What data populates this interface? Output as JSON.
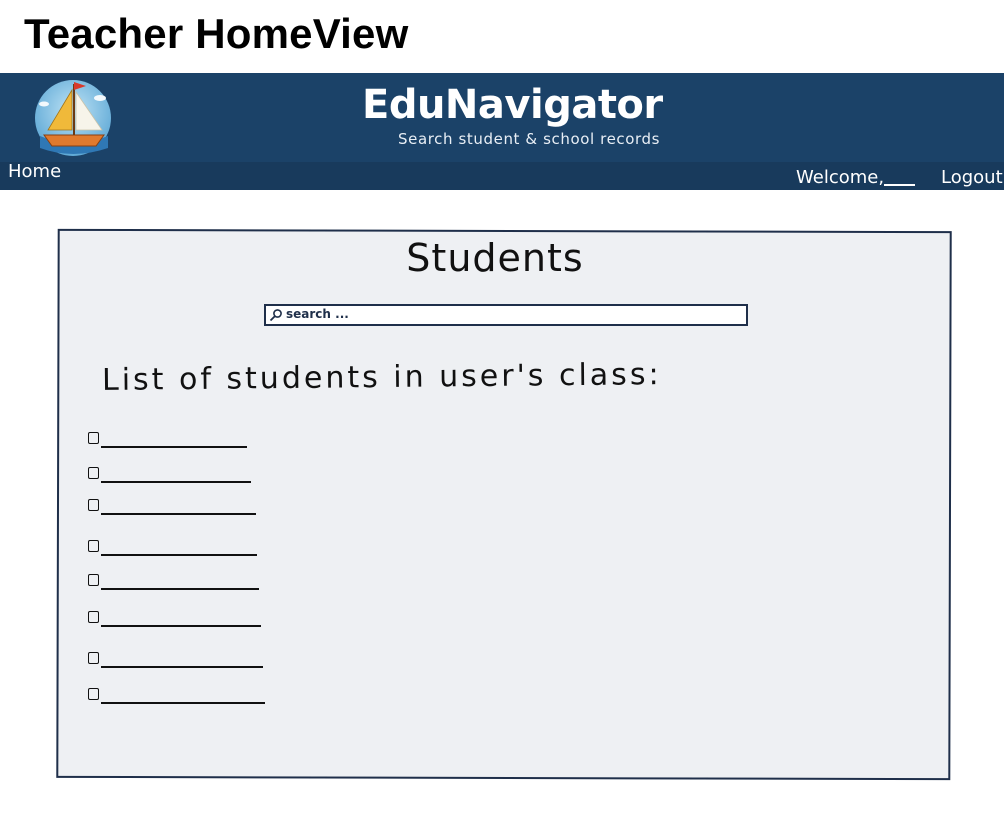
{
  "page_title": "Teacher HomeView",
  "header": {
    "brand_name": "EduNavigator",
    "tagline": "Search student & school records",
    "logo_icon": "sailboat-logo"
  },
  "nav": {
    "home_label": "Home",
    "welcome_label": "Welcome,",
    "logout_label": "Logout"
  },
  "main": {
    "title": "Students",
    "search": {
      "placeholder": "search ...",
      "icon": "search-icon"
    },
    "list_heading": "List of students in user's class:",
    "students": [
      {
        "name": ""
      },
      {
        "name": ""
      },
      {
        "name": ""
      },
      {
        "name": ""
      },
      {
        "name": ""
      },
      {
        "name": ""
      },
      {
        "name": ""
      },
      {
        "name": ""
      }
    ]
  },
  "colors": {
    "banner": "#1b4268",
    "navbar": "#183a5c",
    "panel_bg": "#eef0f3",
    "panel_border": "#1f2f4a"
  }
}
